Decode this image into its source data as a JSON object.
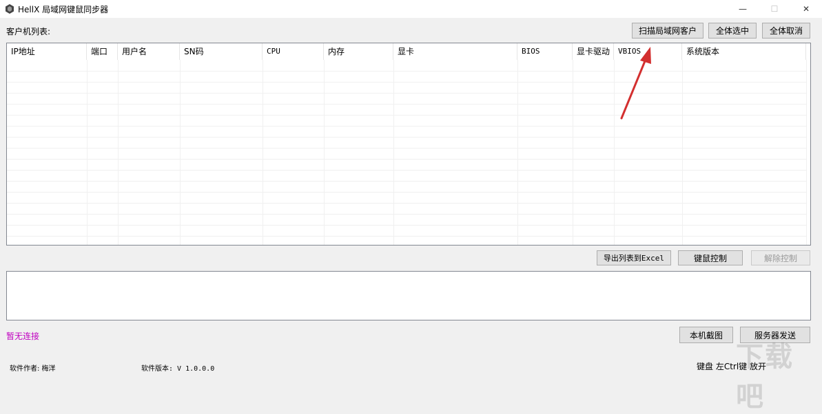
{
  "window": {
    "title": "HellX 局域网键鼠同步器",
    "min_glyph": "—",
    "max_glyph": "☐",
    "close_glyph": "✕"
  },
  "client_list_label": "客户机列表:",
  "top_buttons": {
    "scan": "扫描局域网客户",
    "select_all": "全体选中",
    "cancel_all": "全体取消"
  },
  "table": {
    "columns": [
      "IP地址",
      "端口",
      "用户名",
      "SN码",
      "CPU",
      "内存",
      "显卡",
      "BIOS",
      "显卡驱动",
      "VBIOS",
      "系统版本"
    ],
    "rows": []
  },
  "mid_buttons": {
    "export_excel": "导出列表到Excel",
    "km_control": "键鼠控制",
    "release_control": "解除控制"
  },
  "connection_status": "暂无连接",
  "bottom_buttons": {
    "screenshot": "本机截图",
    "server_send": "服务器发送"
  },
  "footer": {
    "author": "软件作者: 梅洋",
    "version": "软件版本: V 1.0.0.0",
    "hotkey": "键盘 左Ctrl键  放开"
  },
  "watermark": "下载吧",
  "colors": {
    "status_text": "#c000c0",
    "arrow": "#d32f2f"
  }
}
